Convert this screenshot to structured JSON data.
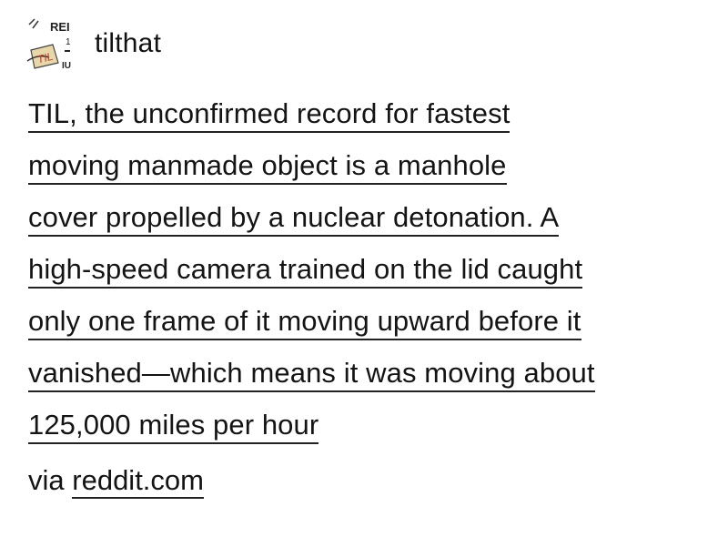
{
  "post": {
    "username": "tilthat",
    "avatar": {
      "icon": "til-logo-icon",
      "text_top": "REI",
      "text_tag": "TIL",
      "text_side": "1",
      "text_bottom": "IU"
    },
    "body_lines": [
      "TIL, the unconfirmed record for fastest",
      "moving manmade object is a manhole",
      "cover propelled by a nuclear detonation. A",
      "high-speed camera trained on the lid caught",
      "only one frame of it moving upward before it",
      "vanished—which means it was moving about",
      "125,000 miles per hour"
    ],
    "source": {
      "prefix": "via",
      "link": "reddit.com"
    }
  }
}
